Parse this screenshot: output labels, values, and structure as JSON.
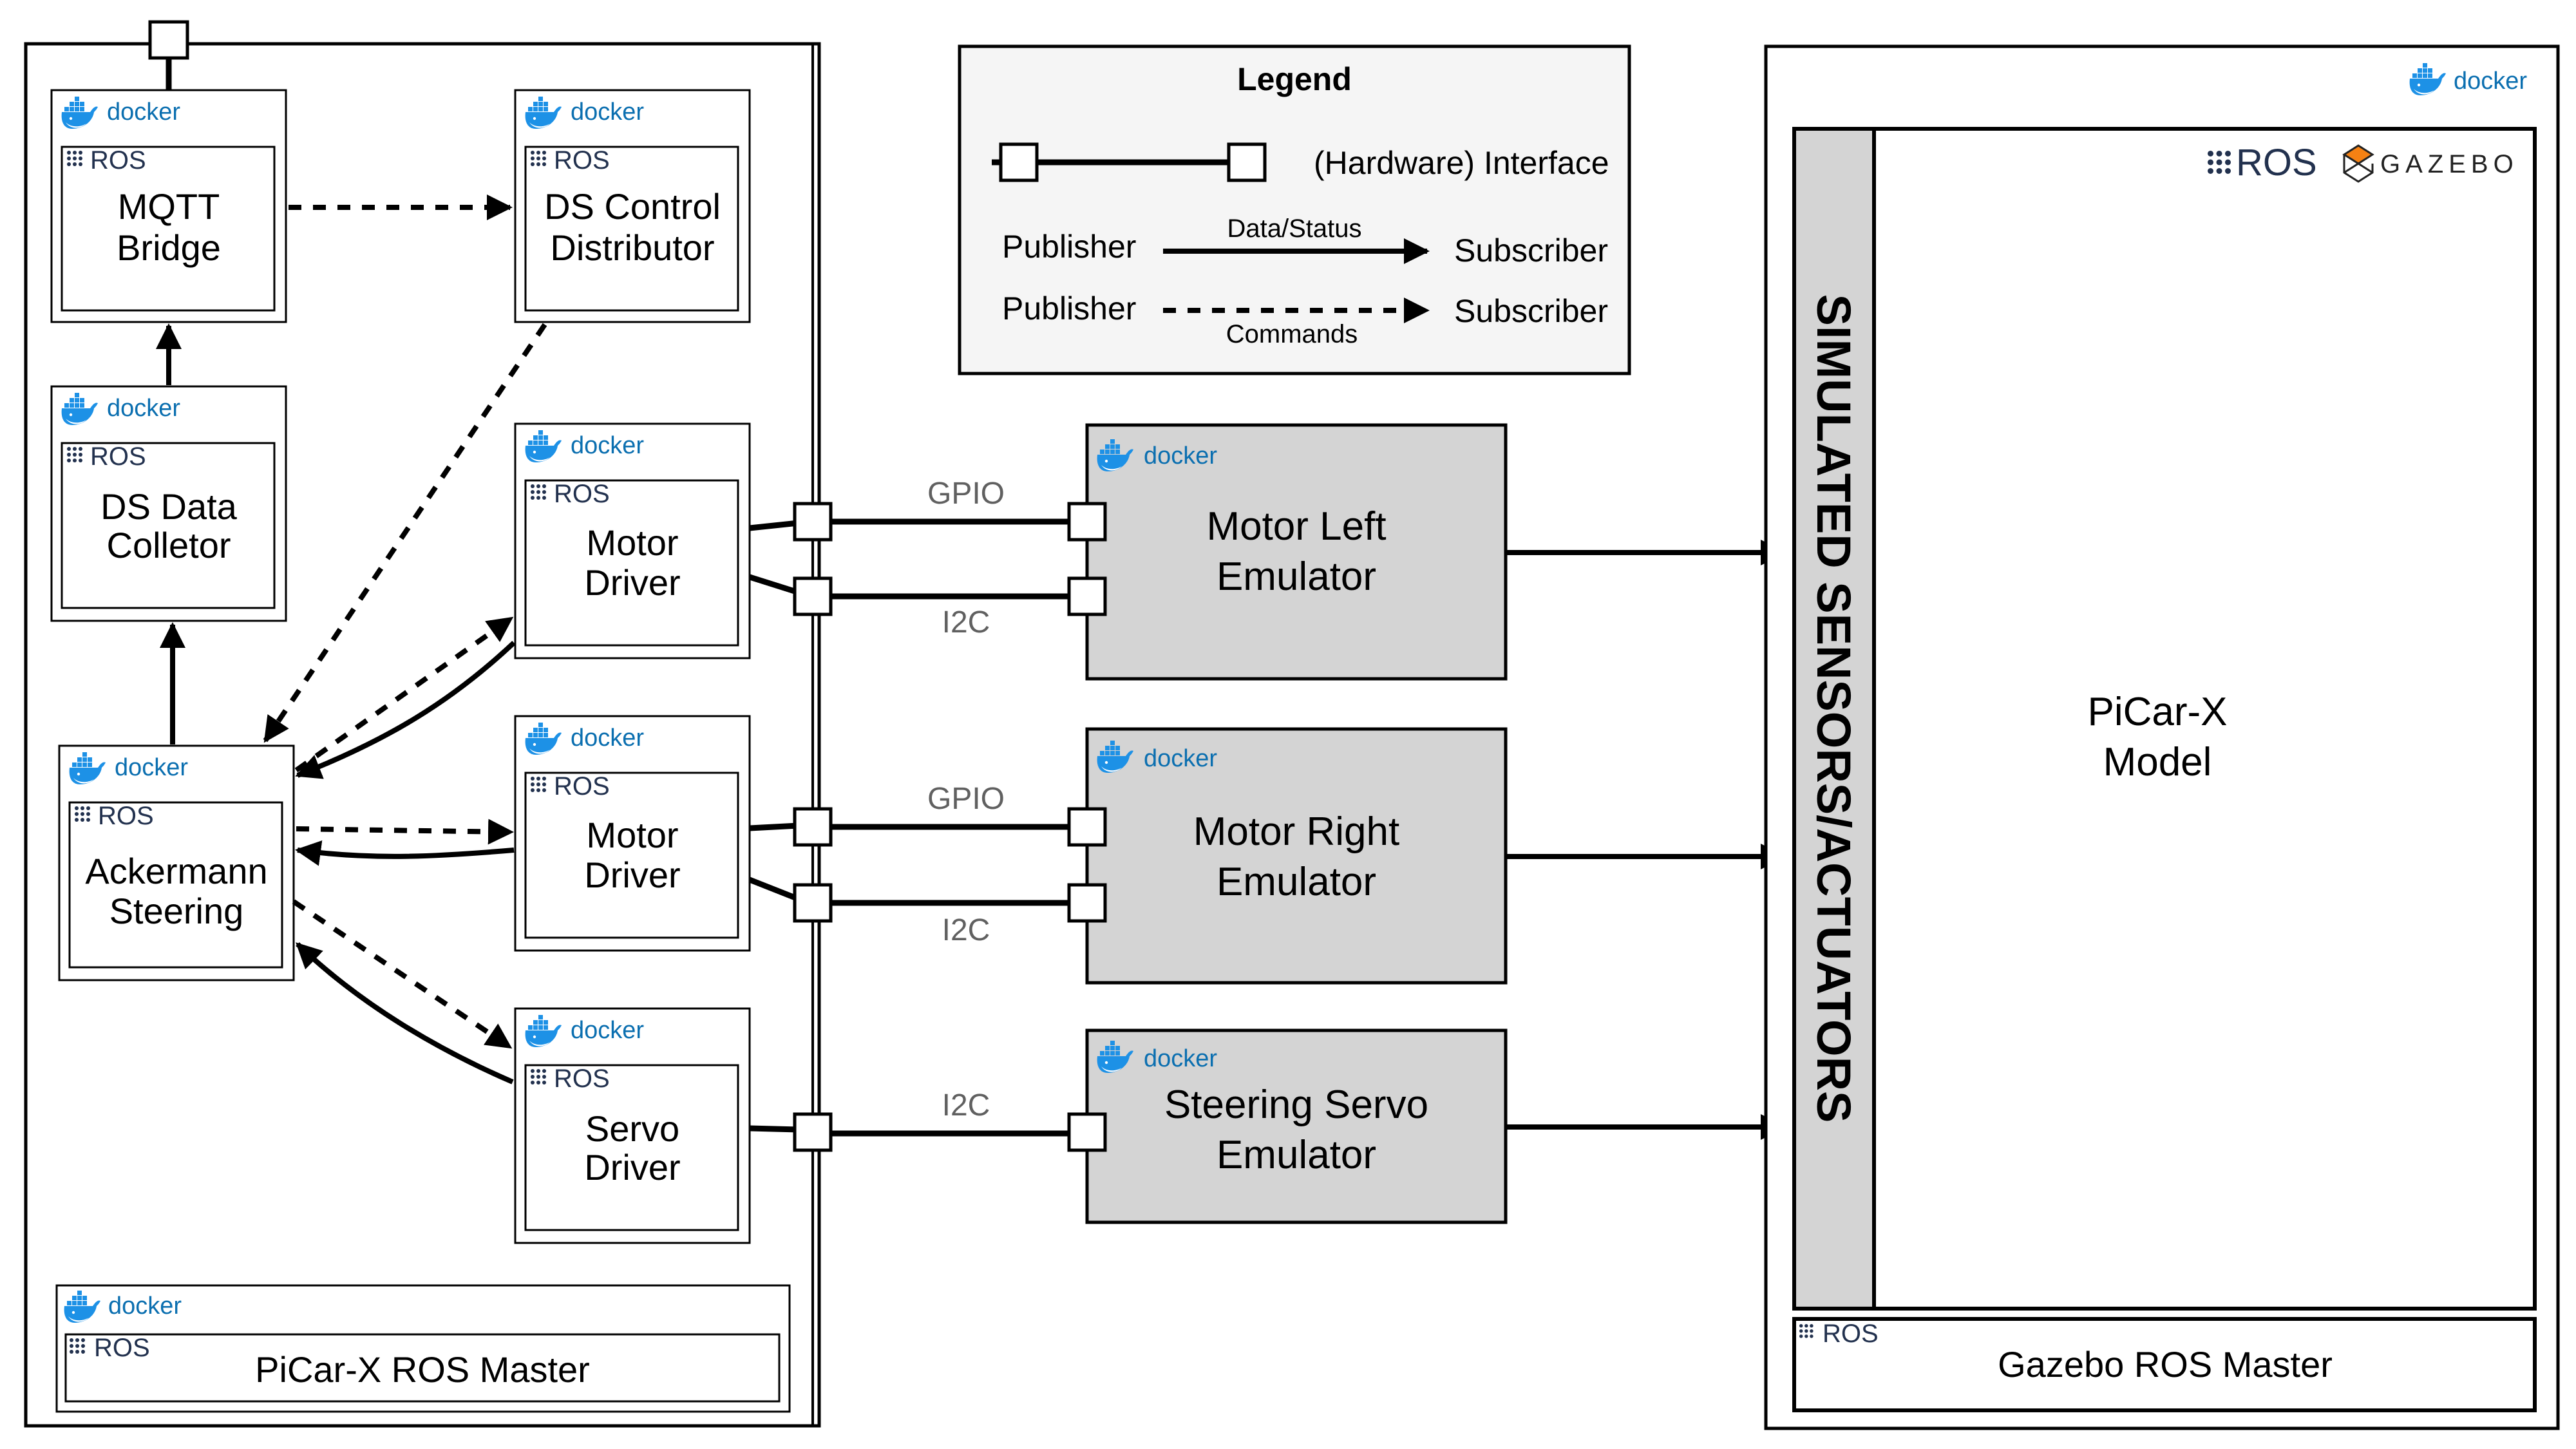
{
  "legend": {
    "title": "Legend",
    "interface_label": "(Hardware) Interface",
    "data_row": {
      "from": "Publisher",
      "label": "Data/Status",
      "to": "Subscriber"
    },
    "command_row": {
      "from": "Publisher",
      "label": "Commands",
      "to": "Subscriber"
    }
  },
  "badges": {
    "docker": "docker",
    "ros": "ROS",
    "gazebo": "GAZEBO"
  },
  "picar_nodes": {
    "mqtt_bridge": [
      "MQTT",
      "Bridge"
    ],
    "ds_control_distributor": [
      "DS Control",
      "Distributor"
    ],
    "ds_data_collector": [
      "DS Data",
      "Colletor"
    ],
    "motor_driver_1": [
      "Motor",
      "Driver"
    ],
    "ackermann_steering": [
      "Ackermann",
      "Steering"
    ],
    "motor_driver_2": [
      "Motor",
      "Driver"
    ],
    "servo_driver": [
      "Servo",
      "Driver"
    ],
    "ros_master": "PiCar-X ROS Master"
  },
  "buses": {
    "motor_left_gpio": "GPIO",
    "motor_left_i2c": "I2C",
    "motor_right_gpio": "GPIO",
    "motor_right_i2c": "I2C",
    "servo_i2c": "I2C"
  },
  "emulators": {
    "motor_left": [
      "Motor Left",
      "Emulator"
    ],
    "motor_right": [
      "Motor Right",
      "Emulator"
    ],
    "steering_servo": [
      "Steering Servo",
      "Emulator"
    ]
  },
  "simulation": {
    "sensors_actuators": "SIMULATED SENSORS/ACTUATORS",
    "model": [
      "PiCar-X",
      "Model"
    ],
    "ros_master": "Gazebo ROS Master"
  },
  "colors": {
    "docker_blue": "#1d91e6",
    "ros_navy": "#22314e",
    "gazebo_orange": "#f58113",
    "emulator_fill": "#d4d4d4",
    "legend_fill": "#f5f5f5",
    "bus_label": "#606060"
  }
}
